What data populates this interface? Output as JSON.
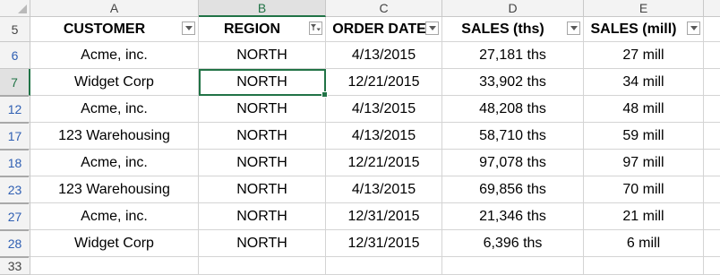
{
  "columns": [
    {
      "letter": "A",
      "header": "CUSTOMER"
    },
    {
      "letter": "B",
      "header": "REGION"
    },
    {
      "letter": "C",
      "header": "ORDER DATE"
    },
    {
      "letter": "D",
      "header": "SALES (ths)"
    },
    {
      "letter": "E",
      "header": "SALES (mill)"
    }
  ],
  "header_row_number": "5",
  "filter_icons": [
    "dropdown-arrow",
    "filter-funnel",
    "dropdown-arrow",
    "dropdown-arrow",
    "dropdown-arrow"
  ],
  "rows": [
    {
      "num": "6",
      "cells": [
        "Acme, inc.",
        "NORTH",
        "4/13/2015",
        "27,181 ths",
        "27 mill"
      ]
    },
    {
      "num": "7",
      "cells": [
        "Widget Corp",
        "NORTH",
        "12/21/2015",
        "33,902 ths",
        "34 mill"
      ]
    },
    {
      "num": "12",
      "cells": [
        "Acme, inc.",
        "NORTH",
        "4/13/2015",
        "48,208 ths",
        "48 mill"
      ]
    },
    {
      "num": "17",
      "cells": [
        "123 Warehousing",
        "NORTH",
        "4/13/2015",
        "58,710 ths",
        "59 mill"
      ]
    },
    {
      "num": "18",
      "cells": [
        "Acme, inc.",
        "NORTH",
        "12/21/2015",
        "97,078 ths",
        "97 mill"
      ]
    },
    {
      "num": "23",
      "cells": [
        "123 Warehousing",
        "NORTH",
        "4/13/2015",
        "69,856 ths",
        "70 mill"
      ]
    },
    {
      "num": "27",
      "cells": [
        "Acme, inc.",
        "NORTH",
        "12/31/2015",
        "21,346 ths",
        "21 mill"
      ]
    },
    {
      "num": "28",
      "cells": [
        "Widget Corp",
        "NORTH",
        "12/31/2015",
        "6,396 ths",
        "6 mill"
      ]
    }
  ],
  "trailing_row_number": "33",
  "selected_cell": "B7",
  "colors": {
    "accent": "#217346",
    "filtered_row_number": "#2f5fb3",
    "header_bg": "#f3f3f3"
  }
}
